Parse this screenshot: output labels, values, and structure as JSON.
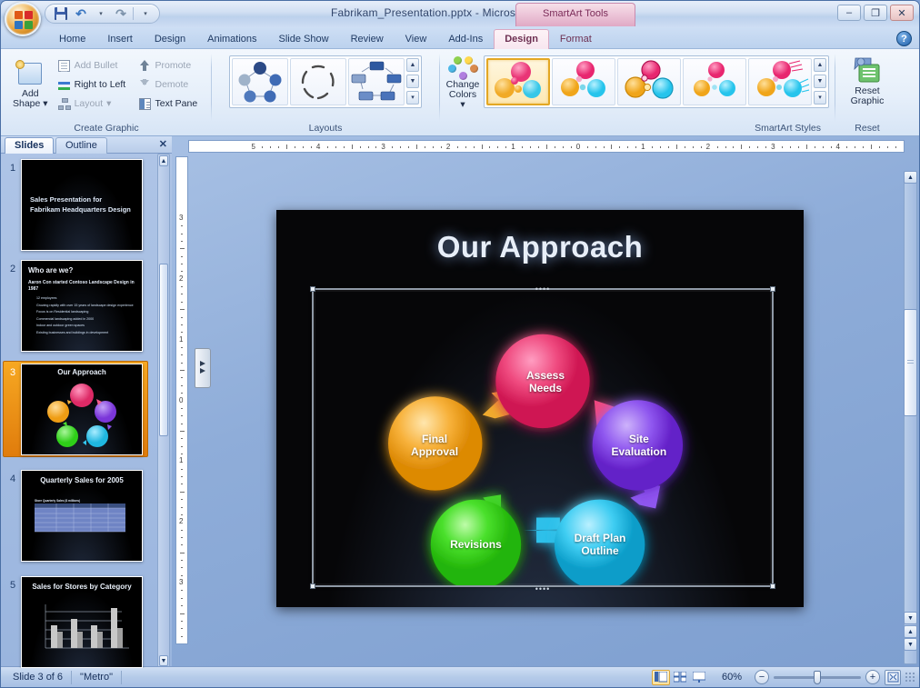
{
  "window": {
    "title": "Fabrikam_Presentation.pptx - Microsoft PowerPoint",
    "context_tab_header": "SmartArt Tools",
    "minimize": "–",
    "maximize": "❐",
    "close": "✕",
    "help": "?"
  },
  "quick_access": {
    "save": "Save",
    "undo": "Undo",
    "redo": "Redo",
    "customize": "Customize Quick Access Toolbar"
  },
  "ribbon_tabs": [
    {
      "label": "Home",
      "active": false
    },
    {
      "label": "Insert",
      "active": false
    },
    {
      "label": "Design",
      "active": false
    },
    {
      "label": "Animations",
      "active": false
    },
    {
      "label": "Slide Show",
      "active": false
    },
    {
      "label": "Review",
      "active": false
    },
    {
      "label": "View",
      "active": false
    },
    {
      "label": "Add-Ins",
      "active": false
    },
    {
      "label": "Design",
      "active": true,
      "contextual": true
    },
    {
      "label": "Format",
      "active": false,
      "contextual": true
    }
  ],
  "ribbon": {
    "create_graphic": {
      "group_label": "Create Graphic",
      "add_shape": "Add\nShape",
      "add_shape_line1": "Add",
      "add_shape_line2": "Shape",
      "commands": [
        {
          "label": "Add Bullet",
          "icon": "bullet-icon",
          "disabled": true
        },
        {
          "label": "Right to Left",
          "icon": "right-to-left-icon",
          "disabled": false
        },
        {
          "label": "Layout",
          "icon": "layout-icon",
          "disabled": true
        },
        {
          "label": "Promote",
          "icon": "promote-icon",
          "disabled": true
        },
        {
          "label": "Demote",
          "icon": "demote-icon",
          "disabled": true
        },
        {
          "label": "Text Pane",
          "icon": "text-pane-icon",
          "disabled": false
        }
      ]
    },
    "layouts": {
      "group_label": "Layouts",
      "items": [
        {
          "name": "basic-cycle-layout",
          "selected": false
        },
        {
          "name": "text-cycle-layout",
          "selected": false
        },
        {
          "name": "block-cycle-layout",
          "selected": false
        }
      ],
      "scroll_up": "▲",
      "scroll_down": "▼",
      "more": "▾"
    },
    "smartart_styles": {
      "group_label": "SmartArt Styles",
      "change_colors_line1": "Change",
      "change_colors_line2": "Colors",
      "change_colors": "Change Colors",
      "items": [
        {
          "name": "style-subtle-effect",
          "selected": true
        },
        {
          "name": "style-moderate-effect",
          "selected": false
        },
        {
          "name": "style-intense-effect",
          "selected": false
        },
        {
          "name": "style-polished",
          "selected": false
        },
        {
          "name": "style-cartoon",
          "selected": false
        }
      ],
      "scroll_up": "▲",
      "scroll_down": "▼",
      "more": "▾"
    },
    "reset": {
      "group_label": "Reset",
      "reset_graphic_line1": "Reset",
      "reset_graphic_line2": "Graphic",
      "reset_graphic": "Reset Graphic"
    }
  },
  "left_pane": {
    "tabs": [
      {
        "label": "Slides",
        "active": true
      },
      {
        "label": "Outline",
        "active": false
      }
    ],
    "close": "✕",
    "slides": [
      {
        "number": "1",
        "kind": "title",
        "title": "Sales Presentation for Fabrikam Headquarters Design",
        "selected": false
      },
      {
        "number": "2",
        "kind": "bullets",
        "title": "Who are we?",
        "subtitle": "Aaron Con started Contoso Landscape Design in 1987",
        "bullets": [
          "12 employees",
          "Growing rapidly with over 15 years of landscape design experience",
          "Focus is on Residential landscaping",
          "Commercial landscaping added in 2000",
          "Indoor and outdoor green spaces",
          "Existing businesses and buildings in development"
        ],
        "selected": false
      },
      {
        "number": "3",
        "kind": "smartart",
        "title": "Our Approach",
        "selected": true
      },
      {
        "number": "4",
        "kind": "table",
        "title": "Quarterly Sales for 2005",
        "selected": false
      },
      {
        "number": "5",
        "kind": "chart",
        "title": "Sales for Stores by Category",
        "selected": false
      }
    ]
  },
  "rulers": {
    "horizontal": [
      "5",
      "4",
      "3",
      "2",
      "1",
      "0",
      "1",
      "2",
      "3",
      "4"
    ],
    "vertical": [
      "3",
      "2",
      "1",
      "0",
      "1",
      "2",
      "3"
    ]
  },
  "slide": {
    "title": "Our Approach",
    "smartart": {
      "name": "basic-cycle-diagram",
      "nodes": [
        {
          "label_line1": "Assess",
          "label_line2": "Needs",
          "label": "Assess Needs",
          "color": "#e8396f",
          "position": "top"
        },
        {
          "label_line1": "Site",
          "label_line2": "Evaluation",
          "label": "Site Evaluation",
          "color": "#8c4de6",
          "position": "right"
        },
        {
          "label_line1": "Draft Plan",
          "label_line2": "Outline",
          "label": "Draft Plan Outline",
          "color": "#33c6f0",
          "position": "bottom-right"
        },
        {
          "label_line1": "Revisions",
          "label_line2": "",
          "label": "Revisions",
          "color": "#3fdd2a",
          "position": "bottom-left"
        },
        {
          "label_line1": "Final",
          "label_line2": "Approval",
          "label": "Final Approval",
          "color": "#f5a72a",
          "position": "left"
        }
      ],
      "arrow_colors": [
        "#ee4c7e",
        "#8c4de6",
        "#2fc0ea",
        "#45d42f",
        "#f0ab2f"
      ]
    },
    "text_pane_toggle": "Text Pane"
  },
  "status_bar": {
    "slide_indicator": "Slide 3 of 6",
    "theme": "\"Metro\"",
    "views": [
      {
        "name": "normal-view-button",
        "active": true
      },
      {
        "name": "slide-sorter-view-button",
        "active": false
      },
      {
        "name": "slide-show-view-button",
        "active": false
      }
    ],
    "zoom_level": "60%",
    "zoom_out": "−",
    "zoom_in": "+",
    "fit_to_window": "fit-slide-to-window"
  },
  "colors": {
    "accent_orange": "#e8830f",
    "contextual_pink": "#e0a9c5",
    "selection_gold": "#e3a723"
  }
}
